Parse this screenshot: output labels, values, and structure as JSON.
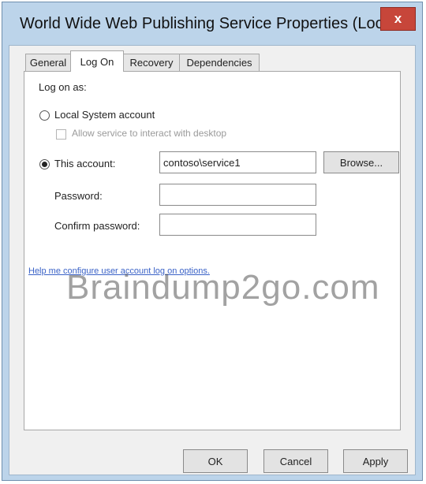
{
  "window": {
    "title": "World Wide Web Publishing Service Properties (Local ...",
    "close_label": "x"
  },
  "tabs": [
    {
      "label": "General",
      "active": false
    },
    {
      "label": "Log On",
      "active": true
    },
    {
      "label": "Recovery",
      "active": false
    },
    {
      "label": "Dependencies",
      "active": false
    }
  ],
  "logon": {
    "section_label": "Log on as:",
    "local_system": {
      "label": "Local System account",
      "selected": false
    },
    "allow_interact": {
      "label": "Allow service to interact with desktop",
      "checked": false,
      "enabled": false
    },
    "this_account": {
      "label": "This account:",
      "selected": true,
      "value": "contoso\\service1"
    },
    "browse_label": "Browse...",
    "password": {
      "label": "Password:",
      "value": ""
    },
    "confirm_password": {
      "label": "Confirm password:",
      "value": ""
    },
    "help_link": "Help me configure user account log on options."
  },
  "watermark": "Braindump2go.com",
  "buttons": {
    "ok": "OK",
    "cancel": "Cancel",
    "apply": "Apply"
  },
  "colors": {
    "title_bar": "#bcd4ea",
    "close_button": "#c7463a",
    "dialog_background": "#f0f0f0",
    "link": "#3a62c7"
  }
}
